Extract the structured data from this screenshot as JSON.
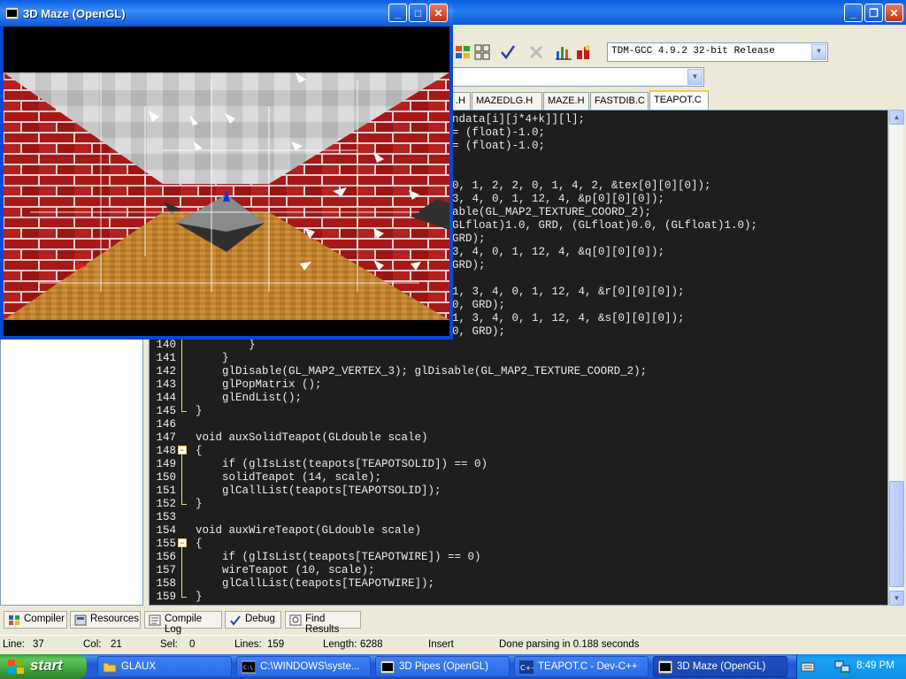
{
  "maze_window": {
    "title": "3D Maze (OpenGL)",
    "controls": {
      "minimize": "_",
      "maximize": "□",
      "close": "✕"
    }
  },
  "devcpp": {
    "window_controls": {
      "minimize": "_",
      "restore": "❐",
      "close": "✕"
    },
    "compiler_select": "TDM-GCC 4.9.2 32-bit Release",
    "file_tabs": [
      {
        "label": ".H"
      },
      {
        "label": "MAZEDLG.H"
      },
      {
        "label": "MAZE.H"
      },
      {
        "label": "FASTDIB.C"
      },
      {
        "label": "TEAPOT.C",
        "active": true
      }
    ],
    "code_partial": [
      {
        "text": "ndata[i][j*4+k]][l];"
      },
      {
        "text": "= (float)-1.0;"
      },
      {
        "text": "= (float)-1.0;"
      },
      {
        "text": ""
      },
      {
        "text": ""
      },
      {
        "text": "0, 1, 2, 2, 0, 1, 4, 2, &tex[0][0][0]);"
      },
      {
        "text": "3, 4, 0, 1, 12, 4, &p[0][0][0]);"
      },
      {
        "text": "able(GL_MAP2_TEXTURE_COORD_2);"
      },
      {
        "text": "GLfloat)1.0, GRD, (GLfloat)0.0, (GLfloat)1.0);"
      },
      {
        "text": "GRD);"
      },
      {
        "text": "3, 4, 0, 1, 12, 4, &q[0][0][0]);"
      },
      {
        "text": "GRD);"
      },
      {
        "text": ""
      },
      {
        "text": "1, 3, 4, 0, 1, 12, 4, &r[0][0][0]);"
      },
      {
        "text": "0, GRD);"
      },
      {
        "text": "1, 3, 4, 0, 1, 12, 4, &s[0][0][0]);"
      },
      {
        "text": "0, GRD);"
      }
    ],
    "code_lines": [
      {
        "num": "140",
        "text": "        }"
      },
      {
        "num": "141",
        "text": "    }"
      },
      {
        "num": "142",
        "text": "    glDisable(GL_MAP2_VERTEX_3); glDisable(GL_MAP2_TEXTURE_COORD_2);"
      },
      {
        "num": "143",
        "text": "    glPopMatrix ();"
      },
      {
        "num": "144",
        "text": "    glEndList();"
      },
      {
        "num": "145",
        "text": "}"
      },
      {
        "num": "146",
        "text": ""
      },
      {
        "num": "147",
        "text": "void auxSolidTeapot(GLdouble scale)"
      },
      {
        "num": "148",
        "text": "{"
      },
      {
        "num": "149",
        "text": "    if (glIsList(teapots[TEAPOTSOLID]) == 0)"
      },
      {
        "num": "150",
        "text": "    solidTeapot (14, scale);"
      },
      {
        "num": "151",
        "text": "    glCallList(teapots[TEAPOTSOLID]);"
      },
      {
        "num": "152",
        "text": "}"
      },
      {
        "num": "153",
        "text": ""
      },
      {
        "num": "154",
        "text": "void auxWireTeapot(GLdouble scale)"
      },
      {
        "num": "155",
        "text": "{"
      },
      {
        "num": "156",
        "text": "    if (glIsList(teapots[TEAPOTWIRE]) == 0)"
      },
      {
        "num": "157",
        "text": "    wireTeapot (10, scale);"
      },
      {
        "num": "158",
        "text": "    glCallList(teapots[TEAPOTWIRE]);"
      },
      {
        "num": "159",
        "text": "}"
      }
    ],
    "bottom_tabs": [
      {
        "label": "Compiler",
        "icon": "compiler-icon"
      },
      {
        "label": "Resources",
        "icon": "resources-icon"
      },
      {
        "label": "Compile Log",
        "icon": "compile-log-icon"
      },
      {
        "label": "Debug",
        "icon": "debug-check-icon"
      },
      {
        "label": "Find Results",
        "icon": "find-results-icon"
      }
    ],
    "status": {
      "line_label": "Line:",
      "line_value": "37",
      "col_label": "Col:",
      "col_value": "21",
      "sel_label": "Sel:",
      "sel_value": "0",
      "lines_label": "Lines:",
      "lines_value": "159",
      "length_label": "Length:",
      "length_value": "6288",
      "mode": "Insert",
      "message": "Done parsing in 0.188 seconds"
    }
  },
  "taskbar": {
    "start_label": "start",
    "tasks": [
      {
        "label": "GLAUX",
        "icon": "folder-icon"
      },
      {
        "label": "C:\\WINDOWS\\syste...",
        "icon": "console-icon"
      },
      {
        "label": "3D Pipes (OpenGL)",
        "icon": "opengl-window-icon"
      },
      {
        "label": "TEAPOT.C - Dev-C++",
        "icon": "devcpp-icon"
      },
      {
        "label": "3D Maze (OpenGL)",
        "icon": "opengl-window-icon",
        "active": true
      }
    ],
    "clock": "8:49 PM"
  },
  "colors": {
    "editor_bg": "#1e1e1e",
    "number_yellow": "#e8e86a",
    "brick_red": "#b01818",
    "floor_orange": "#c0822e",
    "xp_blue": "#0a5ee0",
    "start_green": "#3c9c3c"
  }
}
